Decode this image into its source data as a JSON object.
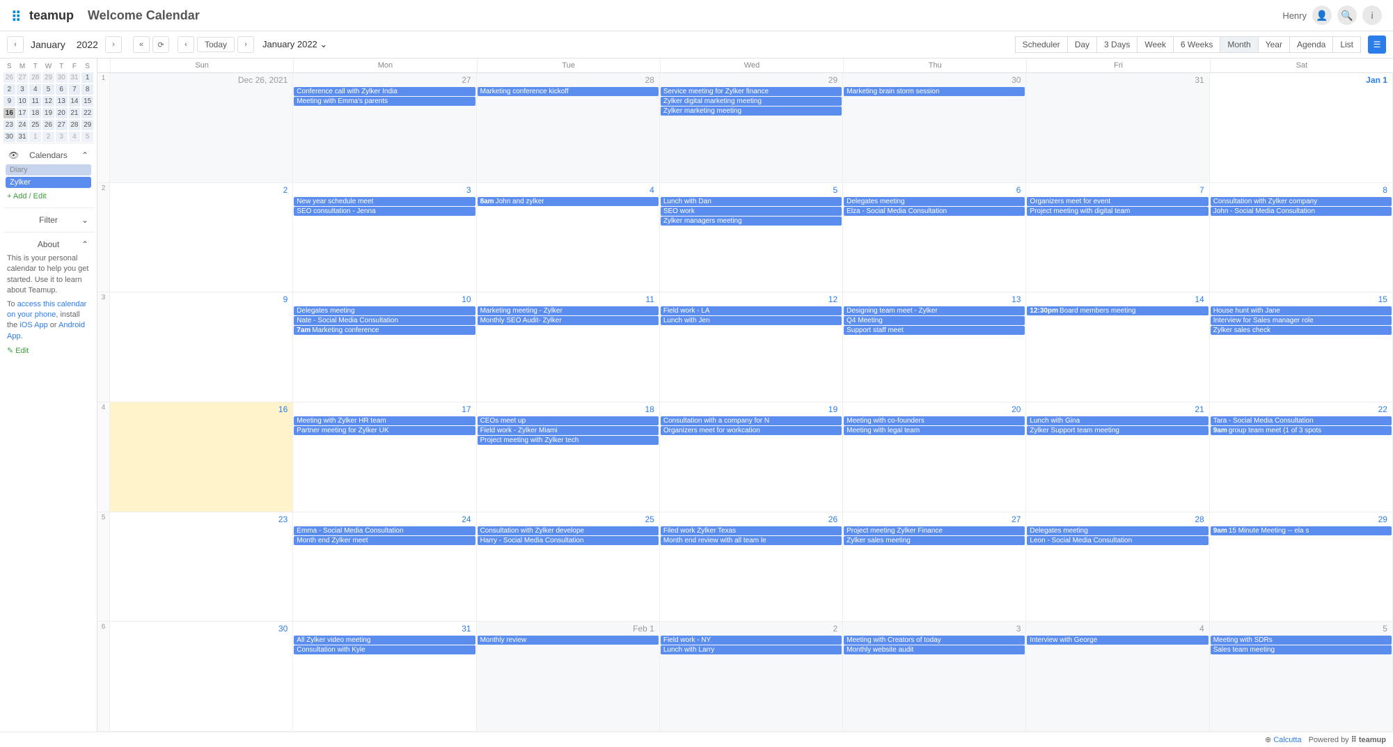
{
  "header": {
    "logo": "teamup",
    "title": "Welcome Calendar",
    "username": "Henry"
  },
  "toolbar": {
    "month": "January",
    "year": "2022",
    "today": "Today",
    "dropdown": "January 2022",
    "views": [
      "Scheduler",
      "Day",
      "3 Days",
      "Week",
      "6 Weeks",
      "Month",
      "Year",
      "Agenda",
      "List"
    ],
    "active_view": "Month"
  },
  "mini_cal": {
    "month": "January",
    "year": "2022",
    "dow": [
      "S",
      "M",
      "T",
      "W",
      "T",
      "F",
      "S"
    ],
    "cells": [
      {
        "n": "26",
        "dim": true
      },
      {
        "n": "27",
        "dim": true
      },
      {
        "n": "28",
        "dim": true
      },
      {
        "n": "29",
        "dim": true
      },
      {
        "n": "30",
        "dim": true
      },
      {
        "n": "31",
        "dim": true
      },
      {
        "n": "1"
      },
      {
        "n": "2"
      },
      {
        "n": "3"
      },
      {
        "n": "4"
      },
      {
        "n": "5"
      },
      {
        "n": "6"
      },
      {
        "n": "7"
      },
      {
        "n": "8"
      },
      {
        "n": "9"
      },
      {
        "n": "10"
      },
      {
        "n": "11"
      },
      {
        "n": "12"
      },
      {
        "n": "13"
      },
      {
        "n": "14"
      },
      {
        "n": "15"
      },
      {
        "n": "16",
        "today": true
      },
      {
        "n": "17"
      },
      {
        "n": "18"
      },
      {
        "n": "19"
      },
      {
        "n": "20"
      },
      {
        "n": "21"
      },
      {
        "n": "22"
      },
      {
        "n": "23"
      },
      {
        "n": "24"
      },
      {
        "n": "25"
      },
      {
        "n": "26"
      },
      {
        "n": "27"
      },
      {
        "n": "28"
      },
      {
        "n": "29"
      },
      {
        "n": "30"
      },
      {
        "n": "31"
      },
      {
        "n": "1",
        "dim": true
      },
      {
        "n": "2",
        "dim": true
      },
      {
        "n": "3",
        "dim": true
      },
      {
        "n": "4",
        "dim": true
      },
      {
        "n": "5",
        "dim": true
      }
    ]
  },
  "sidebar": {
    "calendars_label": "Calendars",
    "cal_items": [
      {
        "name": "Diary",
        "dim": true
      },
      {
        "name": "Zylker",
        "dim": false
      }
    ],
    "add_edit": "+ Add / Edit",
    "filter_label": "Filter",
    "about_label": "About",
    "about_text1": "This is your personal calendar to help you get started. Use it to learn about Teamup.",
    "about_text2a": "To ",
    "about_link1": "access this calendar on your phone",
    "about_text2b": ", install the ",
    "about_link2": "iOS App",
    "about_text2c": " or ",
    "about_link3": "Android App",
    "about_text2d": ".",
    "edit": "✎ Edit"
  },
  "main_cal": {
    "dow": [
      "Sun",
      "Mon",
      "Tue",
      "Wed",
      "Thu",
      "Fri",
      "Sat"
    ],
    "weeks": [
      {
        "num": "1",
        "days": [
          {
            "label": "Dec 26, 2021",
            "outside": true,
            "events": []
          },
          {
            "label": "27",
            "outside": true,
            "events": [
              {
                "t": "Conference call with Zylker India"
              },
              {
                "t": "Meeting with Emma's parents"
              }
            ]
          },
          {
            "label": "28",
            "outside": true,
            "events": [
              {
                "t": "Marketing conference kickoff"
              }
            ]
          },
          {
            "label": "29",
            "outside": true,
            "events": [
              {
                "t": "Service meeting for Zylker finance"
              },
              {
                "t": "Zylker digital marketing meeting"
              },
              {
                "t": "Zylker marketing meeting"
              }
            ]
          },
          {
            "label": "30",
            "outside": true,
            "events": [
              {
                "t": "Marketing brain storm session"
              }
            ]
          },
          {
            "label": "31",
            "outside": true,
            "events": []
          },
          {
            "label": "Jan 1",
            "jan1": true,
            "events": []
          }
        ]
      },
      {
        "num": "2",
        "days": [
          {
            "label": "2",
            "events": []
          },
          {
            "label": "3",
            "events": [
              {
                "t": "New year schedule meet"
              },
              {
                "t": "SEO consultation - Jenna"
              }
            ]
          },
          {
            "label": "4",
            "events": [
              {
                "time": "8am",
                "t": "John and zylker"
              }
            ]
          },
          {
            "label": "5",
            "events": [
              {
                "t": "Lunch with Dan"
              },
              {
                "t": "SEO work"
              },
              {
                "t": "Zylker managers meeting"
              }
            ]
          },
          {
            "label": "6",
            "events": [
              {
                "t": "Delegates meeting"
              },
              {
                "t": "Elza - Social Media Consultation"
              }
            ]
          },
          {
            "label": "7",
            "events": [
              {
                "t": "Organizers meet for event"
              },
              {
                "t": "Project meeting with digital team"
              }
            ]
          },
          {
            "label": "8",
            "events": [
              {
                "t": "Consultation with Zylker company"
              },
              {
                "t": "John - Social Media Consultation"
              }
            ]
          }
        ]
      },
      {
        "num": "3",
        "days": [
          {
            "label": "9",
            "events": []
          },
          {
            "label": "10",
            "events": [
              {
                "t": "Delegates meeting"
              },
              {
                "t": "Nate - Social Media Consultation"
              },
              {
                "time": "7am",
                "t": "Marketing conference"
              }
            ]
          },
          {
            "label": "11",
            "events": [
              {
                "t": "Marketing meeting - Zylker"
              },
              {
                "t": "Monthly SEO Audit- Zylker"
              }
            ]
          },
          {
            "label": "12",
            "events": [
              {
                "t": "Field work - LA"
              },
              {
                "t": "Lunch with Jen"
              }
            ]
          },
          {
            "label": "13",
            "events": [
              {
                "t": "Designing team meet - Zylker"
              },
              {
                "t": "Q4 Meeting"
              },
              {
                "t": "Support staff meet"
              }
            ]
          },
          {
            "label": "14",
            "events": [
              {
                "time": "12:30pm",
                "t": "Board members meeting"
              }
            ]
          },
          {
            "label": "15",
            "events": [
              {
                "t": "House hunt with Jane"
              },
              {
                "t": "Interview for Sales manager role"
              },
              {
                "t": "Zylker sales check"
              }
            ]
          }
        ]
      },
      {
        "num": "4",
        "days": [
          {
            "label": "16",
            "today": true,
            "events": []
          },
          {
            "label": "17",
            "events": [
              {
                "t": "Meeting with Zylker HR team"
              },
              {
                "t": "Partner meeting for Zylker UK"
              }
            ]
          },
          {
            "label": "18",
            "events": [
              {
                "t": "CEOs meet up"
              },
              {
                "t": "Field work - Zylker Miami"
              },
              {
                "t": "Project meeting with Zylker tech"
              }
            ]
          },
          {
            "label": "19",
            "events": [
              {
                "t": "Consultation with a company for N"
              },
              {
                "t": "Organizers meet for workcation"
              }
            ]
          },
          {
            "label": "20",
            "events": [
              {
                "t": "Meeting with co-founders"
              },
              {
                "t": "Meeting with legal team"
              }
            ]
          },
          {
            "label": "21",
            "events": [
              {
                "t": "Lunch with Gina"
              },
              {
                "t": "Zylker Support team meeting"
              }
            ]
          },
          {
            "label": "22",
            "events": [
              {
                "t": "Tara - Social Media Consultation"
              },
              {
                "time": "9am",
                "t": "group team meet (1 of 3 spots"
              }
            ]
          }
        ]
      },
      {
        "num": "5",
        "days": [
          {
            "label": "23",
            "events": []
          },
          {
            "label": "24",
            "events": [
              {
                "t": "Emma - Social Media Consultation"
              },
              {
                "t": "Month end Zylker meet"
              }
            ]
          },
          {
            "label": "25",
            "events": [
              {
                "t": "Consultation with Zylker develope"
              },
              {
                "t": "Harry - Social Media Consultation"
              }
            ]
          },
          {
            "label": "26",
            "events": [
              {
                "t": "Filed work Zylker Texas"
              },
              {
                "t": "Month end review with all team le"
              }
            ]
          },
          {
            "label": "27",
            "events": [
              {
                "t": "Project meeting Zylker Finance"
              },
              {
                "t": "Zylker sales meeting"
              }
            ]
          },
          {
            "label": "28",
            "events": [
              {
                "t": "Delegates meeting"
              },
              {
                "t": "Leon - Social Media Consultation"
              }
            ]
          },
          {
            "label": "29",
            "events": [
              {
                "time": "9am",
                "t": "15 Minute Meeting -- ela s"
              }
            ]
          }
        ]
      },
      {
        "num": "6",
        "days": [
          {
            "label": "30",
            "events": []
          },
          {
            "label": "31",
            "events": [
              {
                "t": "All Zylker video meeting"
              },
              {
                "t": "Consultation with Kyle"
              }
            ]
          },
          {
            "label": "Feb 1",
            "outside": true,
            "events": [
              {
                "t": "Monthly review"
              }
            ]
          },
          {
            "label": "2",
            "outside": true,
            "events": [
              {
                "t": "Field work - NY"
              },
              {
                "t": "Lunch with Larry"
              }
            ]
          },
          {
            "label": "3",
            "outside": true,
            "events": [
              {
                "t": "Meeting with Creators of today"
              },
              {
                "t": "Monthly website audit"
              }
            ]
          },
          {
            "label": "4",
            "outside": true,
            "events": [
              {
                "t": "Interview with George"
              }
            ]
          },
          {
            "label": "5",
            "outside": true,
            "events": [
              {
                "t": "Meeting with SDRs"
              },
              {
                "t": "Sales team meeting"
              }
            ]
          }
        ]
      }
    ]
  },
  "footer": {
    "tz_icon": "⊕",
    "tz": "Calcutta",
    "powered": "Powered by",
    "logo": "teamup"
  }
}
